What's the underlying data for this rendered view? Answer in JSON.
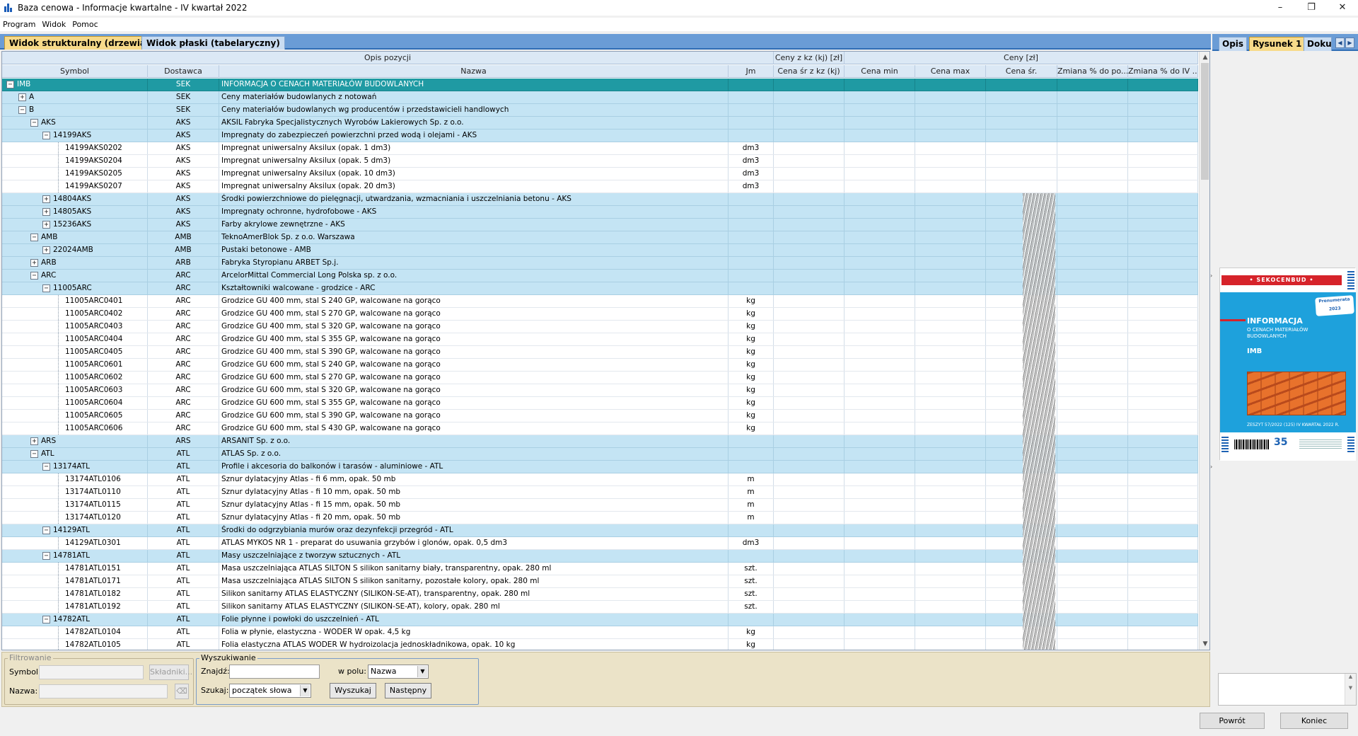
{
  "window": {
    "title": "Baza cenowa - Informacje kwartalne - IV kwartał 2022",
    "minimize": "–",
    "maximize": "❐",
    "close": "✕"
  },
  "menu": [
    "Program",
    "Widok",
    "Pomoc"
  ],
  "tabs": [
    "Widok strukturalny (drzewiasty)",
    "Widok płaski (tabelaryczny)"
  ],
  "grid": {
    "group_headers": {
      "opis": "Opis pozycji",
      "ceny_kz": "Ceny z kz (kj) [zł]",
      "ceny": "Ceny [zł]"
    },
    "columns": {
      "symbol": "Symbol",
      "dostawca": "Dostawca",
      "nazwa": "Nazwa",
      "jm": "Jm",
      "cena_kz": "Cena śr z kz (kj)",
      "cena_min": "Cena min",
      "cena_max": "Cena max",
      "cena_sr": "Cena śr.",
      "zmiana1": "Zmiana % do po...",
      "zmiana2": "Zmiana % do IV ..."
    },
    "rows": [
      {
        "sym": "IMB",
        "lvl": 0,
        "tg": "−",
        "d": "SEK",
        "n": "INFORMACJA O CENACH MATERIAŁÓW BUDOWLANYCH",
        "jm": "",
        "t": "sel"
      },
      {
        "sym": "A",
        "lvl": 1,
        "tg": "+",
        "d": "SEK",
        "n": "Ceny materiałów budowlanych z notowań",
        "jm": "",
        "t": "g"
      },
      {
        "sym": "B",
        "lvl": 1,
        "tg": "−",
        "d": "SEK",
        "n": "Ceny materiałów budowlanych wg producentów i przedstawicieli handlowych",
        "jm": "",
        "t": "g"
      },
      {
        "sym": "AKS",
        "lvl": 2,
        "tg": "−",
        "d": "AKS",
        "n": "AKSIL Fabryka Specjalistycznych Wyrobów Lakierowych Sp. z o.o.",
        "jm": "",
        "t": "g"
      },
      {
        "sym": "14199AKS",
        "lvl": 3,
        "tg": "−",
        "d": "AKS",
        "n": "Impregnaty do zabezpieczeń powierzchni przed wodą i olejami - AKS",
        "jm": "",
        "t": "g"
      },
      {
        "sym": "14199AKS0202",
        "lvl": 4,
        "tg": "",
        "d": "AKS",
        "n": "Impregnat uniwersalny Aksilux (opak. 1 dm3)",
        "jm": "dm3",
        "t": ""
      },
      {
        "sym": "14199AKS0204",
        "lvl": 4,
        "tg": "",
        "d": "AKS",
        "n": "Impregnat uniwersalny Aksilux (opak. 5 dm3)",
        "jm": "dm3",
        "t": ""
      },
      {
        "sym": "14199AKS0205",
        "lvl": 4,
        "tg": "",
        "d": "AKS",
        "n": "Impregnat uniwersalny Aksilux (opak. 10 dm3)",
        "jm": "dm3",
        "t": ""
      },
      {
        "sym": "14199AKS0207",
        "lvl": 4,
        "tg": "",
        "d": "AKS",
        "n": "Impregnat uniwersalny Aksilux (opak. 20 dm3)",
        "jm": "dm3",
        "t": ""
      },
      {
        "sym": "14804AKS",
        "lvl": 3,
        "tg": "+",
        "d": "AKS",
        "n": "Środki powierzchniowe do pielęgnacji, utwardzania, wzmacniania i uszczelniania betonu - AKS",
        "jm": "",
        "t": "g"
      },
      {
        "sym": "14805AKS",
        "lvl": 3,
        "tg": "+",
        "d": "AKS",
        "n": "Impregnaty ochronne, hydrofobowe - AKS",
        "jm": "",
        "t": "g"
      },
      {
        "sym": "15236AKS",
        "lvl": 3,
        "tg": "+",
        "d": "AKS",
        "n": "Farby akrylowe zewnętrzne - AKS",
        "jm": "",
        "t": "g"
      },
      {
        "sym": "AMB",
        "lvl": 2,
        "tg": "−",
        "d": "AMB",
        "n": "TeknoAmerBlok Sp. z o.o. Warszawa",
        "jm": "",
        "t": "g"
      },
      {
        "sym": "22024AMB",
        "lvl": 3,
        "tg": "+",
        "d": "AMB",
        "n": "Pustaki betonowe - AMB",
        "jm": "",
        "t": "g"
      },
      {
        "sym": "ARB",
        "lvl": 2,
        "tg": "+",
        "d": "ARB",
        "n": "Fabryka Styropianu ARBET Sp.j.",
        "jm": "",
        "t": "g"
      },
      {
        "sym": "ARC",
        "lvl": 2,
        "tg": "−",
        "d": "ARC",
        "n": "ArcelorMittal Commercial Long Polska sp. z o.o.",
        "jm": "",
        "t": "g"
      },
      {
        "sym": "11005ARC",
        "lvl": 3,
        "tg": "−",
        "d": "ARC",
        "n": "Kształtowniki walcowane - grodzice - ARC",
        "jm": "",
        "t": "g"
      },
      {
        "sym": "11005ARC0401",
        "lvl": 4,
        "tg": "",
        "d": "ARC",
        "n": "Grodzice GU 400 mm, stal S 240 GP, walcowane na gorąco",
        "jm": "kg",
        "t": ""
      },
      {
        "sym": "11005ARC0402",
        "lvl": 4,
        "tg": "",
        "d": "ARC",
        "n": "Grodzice GU 400 mm, stal S 270 GP, walcowane na gorąco",
        "jm": "kg",
        "t": ""
      },
      {
        "sym": "11005ARC0403",
        "lvl": 4,
        "tg": "",
        "d": "ARC",
        "n": "Grodzice GU 400 mm, stal S 320 GP, walcowane na gorąco",
        "jm": "kg",
        "t": ""
      },
      {
        "sym": "11005ARC0404",
        "lvl": 4,
        "tg": "",
        "d": "ARC",
        "n": "Grodzice GU 400 mm, stal S 355 GP, walcowane na gorąco",
        "jm": "kg",
        "t": ""
      },
      {
        "sym": "11005ARC0405",
        "lvl": 4,
        "tg": "",
        "d": "ARC",
        "n": "Grodzice GU 400 mm, stal S 390 GP, walcowane na gorąco",
        "jm": "kg",
        "t": ""
      },
      {
        "sym": "11005ARC0601",
        "lvl": 4,
        "tg": "",
        "d": "ARC",
        "n": "Grodzice GU 600 mm, stal S 240 GP, walcowane na gorąco",
        "jm": "kg",
        "t": ""
      },
      {
        "sym": "11005ARC0602",
        "lvl": 4,
        "tg": "",
        "d": "ARC",
        "n": "Grodzice GU 600 mm, stal S 270 GP, walcowane na gorąco",
        "jm": "kg",
        "t": ""
      },
      {
        "sym": "11005ARC0603",
        "lvl": 4,
        "tg": "",
        "d": "ARC",
        "n": "Grodzice GU 600 mm, stal S 320 GP, walcowane na gorąco",
        "jm": "kg",
        "t": ""
      },
      {
        "sym": "11005ARC0604",
        "lvl": 4,
        "tg": "",
        "d": "ARC",
        "n": "Grodzice GU 600 mm, stal S 355 GP, walcowane na gorąco",
        "jm": "kg",
        "t": ""
      },
      {
        "sym": "11005ARC0605",
        "lvl": 4,
        "tg": "",
        "d": "ARC",
        "n": "Grodzice GU 600 mm, stal S 390 GP, walcowane na gorąco",
        "jm": "kg",
        "t": ""
      },
      {
        "sym": "11005ARC0606",
        "lvl": 4,
        "tg": "",
        "d": "ARC",
        "n": "Grodzice GU 600 mm, stal S 430 GP, walcowane na gorąco",
        "jm": "kg",
        "t": ""
      },
      {
        "sym": "ARS",
        "lvl": 2,
        "tg": "+",
        "d": "ARS",
        "n": "ARSANIT Sp. z o.o.",
        "jm": "",
        "t": "g"
      },
      {
        "sym": "ATL",
        "lvl": 2,
        "tg": "−",
        "d": "ATL",
        "n": "ATLAS Sp. z o.o.",
        "jm": "",
        "t": "g"
      },
      {
        "sym": "13174ATL",
        "lvl": 3,
        "tg": "−",
        "d": "ATL",
        "n": "Profile i akcesoria do balkonów i tarasów - aluminiowe - ATL",
        "jm": "",
        "t": "g"
      },
      {
        "sym": "13174ATL0106",
        "lvl": 4,
        "tg": "",
        "d": "ATL",
        "n": "Sznur dylatacyjny Atlas - fi 6 mm, opak. 50 mb",
        "jm": "m",
        "t": ""
      },
      {
        "sym": "13174ATL0110",
        "lvl": 4,
        "tg": "",
        "d": "ATL",
        "n": "Sznur dylatacyjny Atlas - fi 10 mm, opak. 50 mb",
        "jm": "m",
        "t": ""
      },
      {
        "sym": "13174ATL0115",
        "lvl": 4,
        "tg": "",
        "d": "ATL",
        "n": "Sznur dylatacyjny Atlas - fi 15 mm, opak. 50 mb",
        "jm": "m",
        "t": ""
      },
      {
        "sym": "13174ATL0120",
        "lvl": 4,
        "tg": "",
        "d": "ATL",
        "n": "Sznur dylatacyjny Atlas - fi 20 mm, opak. 50 mb",
        "jm": "m",
        "t": ""
      },
      {
        "sym": "14129ATL",
        "lvl": 3,
        "tg": "−",
        "d": "ATL",
        "n": "Środki do odgrzybiania murów oraz dezynfekcji przegród - ATL",
        "jm": "",
        "t": "g"
      },
      {
        "sym": "14129ATL0301",
        "lvl": 4,
        "tg": "",
        "d": "ATL",
        "n": "ATLAS MYKOS NR 1 - preparat do usuwania grzybów i glonów, opak. 0,5 dm3",
        "jm": "dm3",
        "t": ""
      },
      {
        "sym": "14781ATL",
        "lvl": 3,
        "tg": "−",
        "d": "ATL",
        "n": "Masy uszczelniające z tworzyw sztucznych - ATL",
        "jm": "",
        "t": "g"
      },
      {
        "sym": "14781ATL0151",
        "lvl": 4,
        "tg": "",
        "d": "ATL",
        "n": "Masa uszczelniająca ATLAS SILTON S silikon sanitarny biały, transparentny, opak. 280 ml",
        "jm": "szt.",
        "t": ""
      },
      {
        "sym": "14781ATL0171",
        "lvl": 4,
        "tg": "",
        "d": "ATL",
        "n": "Masa uszczelniająca ATLAS SILTON S silikon sanitarny, pozostałe kolory, opak. 280 ml",
        "jm": "szt.",
        "t": ""
      },
      {
        "sym": "14781ATL0182",
        "lvl": 4,
        "tg": "",
        "d": "ATL",
        "n": "Silikon sanitarny ATLAS ELASTYCZNY (SILIKON-SE-AT), transparentny, opak. 280 ml",
        "jm": "szt.",
        "t": ""
      },
      {
        "sym": "14781ATL0192",
        "lvl": 4,
        "tg": "",
        "d": "ATL",
        "n": "Silikon sanitarny ATLAS ELASTYCZNY (SILIKON-SE-AT), kolory, opak. 280 ml",
        "jm": "szt.",
        "t": ""
      },
      {
        "sym": "14782ATL",
        "lvl": 3,
        "tg": "−",
        "d": "ATL",
        "n": "Folie płynne i powłoki do uszczelnień - ATL",
        "jm": "",
        "t": "g"
      },
      {
        "sym": "14782ATL0104",
        "lvl": 4,
        "tg": "",
        "d": "ATL",
        "n": "Folia w płynie, elastyczna - WODER W opak. 4,5 kg",
        "jm": "kg",
        "t": ""
      },
      {
        "sym": "14782ATL0105",
        "lvl": 4,
        "tg": "",
        "d": "ATL",
        "n": "Folia elastyczna ATLAS WODER W hydroizolacja jednoskładnikowa, opak. 10 kg",
        "jm": "kg",
        "t": ""
      }
    ]
  },
  "filter": {
    "legend": "Filtrowanie",
    "symbol_label": "Symbol:",
    "symbol_value": "",
    "skladniki_btn": "Składniki...",
    "nazwa_label": "Nazwa:",
    "nazwa_value": "",
    "clear_btn": "⌫"
  },
  "search": {
    "legend": "Wyszukiwanie",
    "find_label": "Znajdź:",
    "find_value": "",
    "field_label": "w polu:",
    "field_value": "Nazwa",
    "mode_label": "Szukaj:",
    "mode_value": "początek słowa",
    "search_btn": "Wyszukaj",
    "next_btn": "Następny"
  },
  "right_panel": {
    "tabs": [
      "Opis",
      "Rysunek 1",
      "Doku"
    ],
    "cover": {
      "brand": "• SEKOCENBUD •",
      "title": "INFORMACJA",
      "subtitle": "O CENACH MATERIAŁÓW BUDOWLANYCH",
      "code": "IMB",
      "badge": "Prenumerata 2023",
      "issue": "ZESZYT 57/2022 (125)   IV KWARTAŁ 2022 R.",
      "anniversary": "35"
    }
  },
  "footer": {
    "back": "Powrót",
    "end": "Koniec"
  },
  "colors": {
    "accent": "#2f6db5",
    "selected_row": "#1f9aa3",
    "group_row": "#c4e4f4",
    "active_tab": "#f7da8a"
  }
}
